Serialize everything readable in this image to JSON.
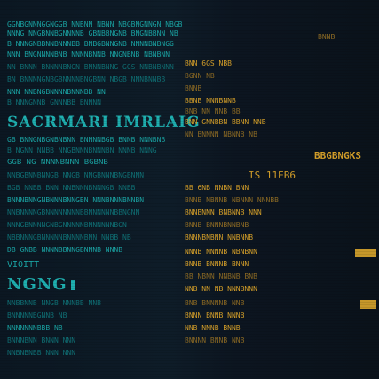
{
  "left_panel": {
    "heading_large": "SACRMARI IMRLAIG",
    "heading_medium": "NGNG",
    "label_small": "VIOITT",
    "rows": [
      "GGNBGNNNGGNGGB NNBNN NBNN NBGBNGNNGN NBGB",
      "NNNG NNGBNNBGNNNNB GBNBBNGNB BNGNBBNN NB",
      "B NNNGNBBNNBNNNBB BNBGBNNGNB NNNNBNBNGG",
      "NNN BNGNNNNBNB NNNNBNNB NNGNBNB NBNBNN",
      "NN BNNN BNNNNBNGN BNNNBNNG GGS NNBNBNNN",
      "BN BNNNNGNBGBNNNNBNGBNN NBGB NNNBNNBB",
      "NNN NNBNGBNNNNBNNNBB NN",
      "B NNNGNNB GNNNBB BNNNN",
      "GB BNNGNBGNBNBNN BNNNNBGB BNNB NNNBNB",
      "B NGNN NNBB NNGBNNNBNNNBN NNNB NNNG",
      "GGB NG NNNNBNNN BGBNB",
      "NNBGBNNBNNGB NNGB NNGBNNNBNGBNNN",
      "BGB NNBB BNN NNBNNNBNNNGB NNBB",
      "BNNNBNNGNBNNNBNNGBN NNNBNNNBNNBN",
      "NNBNNNNGBNNNNNNNNBBNNNNNNBBNGNN",
      "NNNGBNNNNGNBGNNNNNBNNNNNNBGN",
      "NBBNNNGBNNNNNBNNNNBNN NNBB NB",
      "DB GNBB NNNNBBNNGBNNNB NNNB",
      "NNBBNNB NNGB NNNBB NNB",
      "BNNNNNBGNNB NB",
      "NNNNNNNBBB NB",
      "BNNNBNN BNNN NNN",
      "NNBNBNBB NNN NNN"
    ]
  },
  "right_panel": {
    "heading": "IS 11EB6",
    "title_amber": "BBGBNGKS",
    "rows": [
      "BB 6NB NNBN BNN",
      "BNNB NBNNB NBNNN NNNBB",
      "BNN 6GS NBB",
      "BGNN NB",
      "BNNB",
      "BBNB NNNBNNB",
      "BNB NN NNB BB",
      "BNN GNNBBN BBNN NNB",
      "NN BNNNN NBNNB NB",
      "BNNBNNN BNBNNB NNN",
      "BNNB BNNNBNNBNB",
      "BNNNBNBNN NNBNNB",
      "NNNB NNNNB NBNBNN",
      "BNNB BNNNB BNNN",
      "BB NBNN NNBNB BNB",
      "NNB NN NB NNNBNNN",
      "BNB BNNNNB NNB",
      "BNNN BNNB NNNB",
      "NNB NNNB BNNB",
      "BNNNN BNNB NNB"
    ],
    "accent_amber": "#d7a12a"
  },
  "colors": {
    "background": "#0a121c",
    "cyan": "#1aa3a3",
    "amber": "#d7a12a"
  }
}
